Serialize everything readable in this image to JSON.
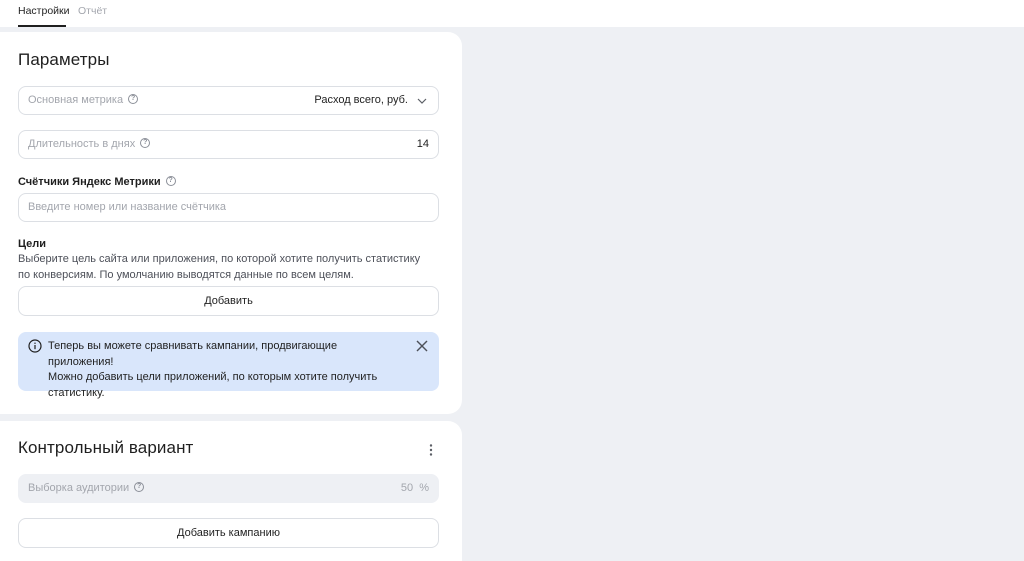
{
  "tabs": [
    {
      "label": "Настройки"
    },
    {
      "label": "Отчёт"
    }
  ],
  "params": {
    "title": "Параметры",
    "metric": {
      "label": "Основная метрика",
      "value": "Расход всего, руб."
    },
    "duration": {
      "label": "Длительность в днях",
      "value": "14"
    },
    "counters": {
      "label": "Счётчики Яндекс Метрики",
      "placeholder": "Введите номер или название счётчика"
    },
    "goals": {
      "label": "Цели",
      "desc_line1": "Выберите цель сайта или приложения, по которой хотите получить статистику",
      "desc_line2": "по конверсиям. По умолчанию выводятся данные по всем целям.",
      "add_label": "Добавить"
    },
    "info": {
      "line1": "Теперь вы можете сравнивать кампании, продвигающие приложения!",
      "line2": "Можно добавить цели приложений, по которым хотите получить",
      "line3": "статистику."
    }
  },
  "control": {
    "title": "Контрольный вариант",
    "audience": {
      "label": "Выборка аудитории",
      "value": "50",
      "unit": "%"
    },
    "add_campaign_label": "Добавить кампанию"
  },
  "colors": {
    "info_bg": "#d9e6fb",
    "page_bg": "#eef0f4"
  }
}
